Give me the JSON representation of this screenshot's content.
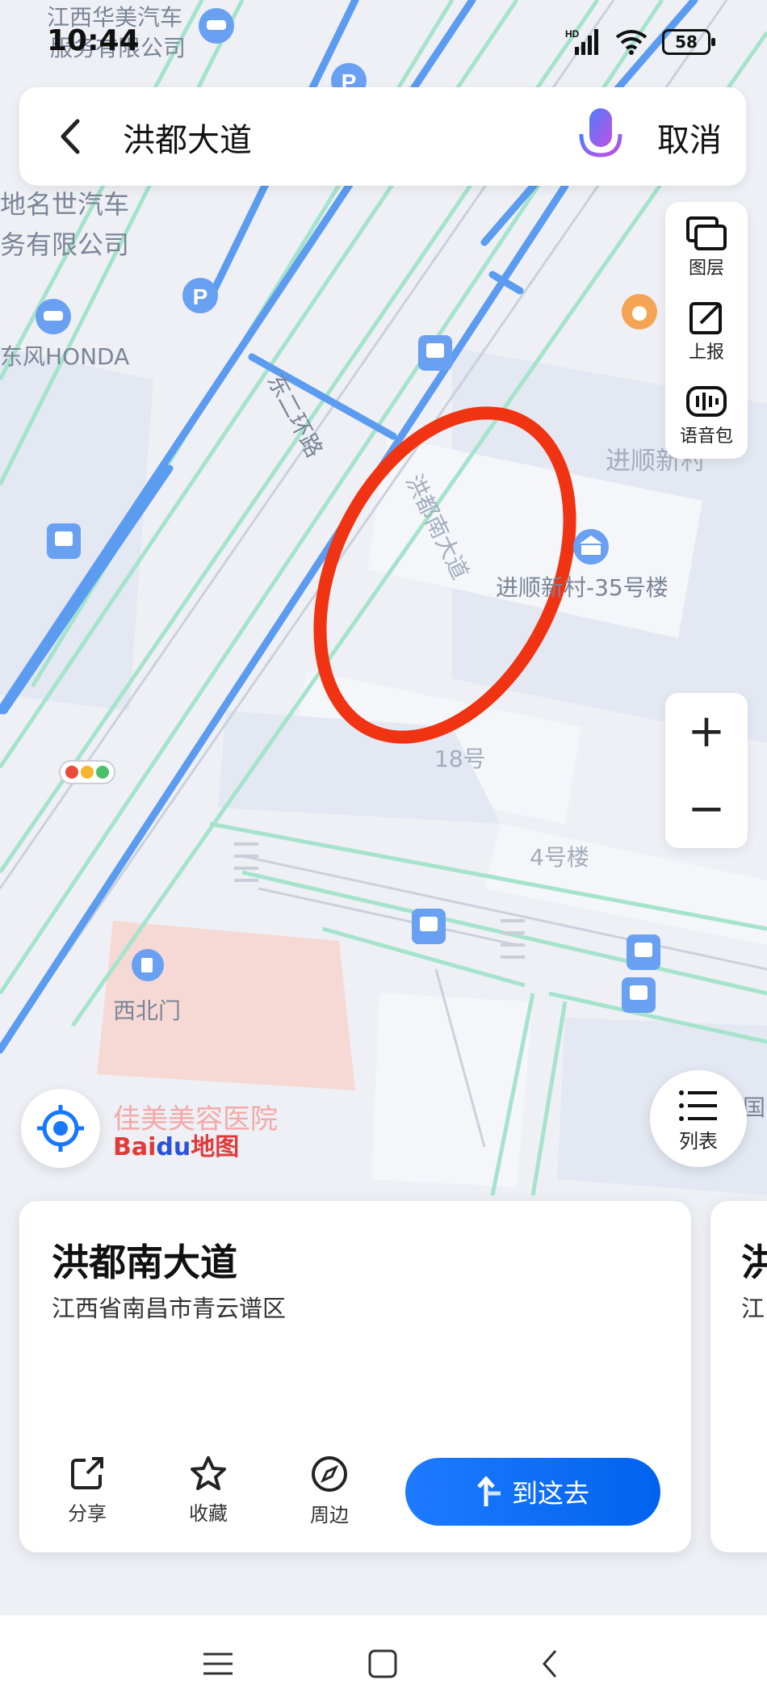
{
  "status_bar": {
    "time": "10:44",
    "signal_tag": "HD",
    "battery": "58"
  },
  "search": {
    "query": "洪都大道",
    "cancel_label": "取消"
  },
  "side_tools": [
    {
      "label": "图层",
      "icon": "layers-icon"
    },
    {
      "label": "上报",
      "icon": "report-icon"
    },
    {
      "label": "语音包",
      "icon": "voice-pack-icon"
    }
  ],
  "zoom": {
    "in": "+",
    "out": "−"
  },
  "list_button": {
    "label": "列表"
  },
  "map": {
    "labels": {
      "jiangxi_huamei": "江西华美汽车",
      "service_company": "服务有限公司",
      "mingshi_1": "地名世汽车",
      "mingshi_2": "务有限公司",
      "dongfeng_honda": "东风HONDA",
      "east_ring_road": "东二环路",
      "hongdu_south_road": "洪都南大道",
      "jinshun_village": "进顺新村",
      "building_35": "进顺新村-35号楼",
      "no18": "18号",
      "building_4": "4号楼",
      "northwest_gate": "西北门",
      "jiamei_hospital": "佳美美容医院",
      "partial_right": "国"
    },
    "logo": {
      "bai": "Bai",
      "du": "du",
      "map": "地图"
    }
  },
  "card": {
    "title": "洪都南大道",
    "address": "江西省南昌市青云谱区",
    "actions": [
      {
        "label": "分享",
        "icon": "share-icon"
      },
      {
        "label": "收藏",
        "icon": "star-icon"
      },
      {
        "label": "周边",
        "icon": "compass-icon"
      }
    ],
    "go_label": "到这去"
  },
  "card2": {
    "title_partial": "洪",
    "sub_partial": "江"
  },
  "colors": {
    "road_blue": "#5b9bf0",
    "road_green": "#a5e3cc",
    "highlight_ellipse": "#f03312",
    "accent": "#1677ff"
  }
}
